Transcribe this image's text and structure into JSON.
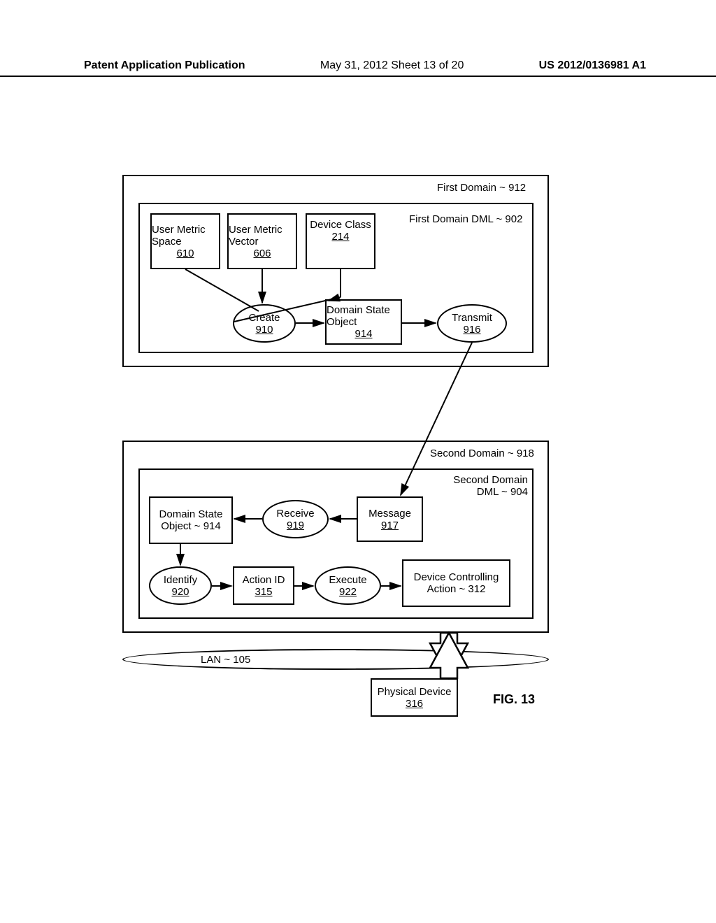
{
  "header": {
    "left": "Patent Application Publication",
    "center": "May 31, 2012  Sheet 13 of 20",
    "right": "US 2012/0136981 A1"
  },
  "domain1": {
    "label": "First Domain ~ 912",
    "dml_label": "First Domain DML ~ 902",
    "user_metric_space": {
      "title": "User Metric Space",
      "ref": "610"
    },
    "user_metric_vector": {
      "title": "User Metric Vector",
      "ref": "606"
    },
    "device_class": {
      "title": "Device Class",
      "ref": "214"
    },
    "create": {
      "title": "Create",
      "ref": "910"
    },
    "domain_state_object": {
      "title": "Domain State Object",
      "ref": "914"
    },
    "transmit": {
      "title": "Transmit",
      "ref": "916"
    }
  },
  "domain2": {
    "label": "Second Domain ~ 918",
    "dml_label": "Second Domain DML ~ 904",
    "domain_state_object": {
      "title": "Domain State Object ~ 914"
    },
    "receive": {
      "title": "Receive",
      "ref": "919"
    },
    "message": {
      "title": "Message",
      "ref": "917"
    },
    "identify": {
      "title": "Identify",
      "ref": "920"
    },
    "action_id": {
      "title": "Action ID",
      "ref": "315"
    },
    "execute": {
      "title": "Execute",
      "ref": "922"
    },
    "device_controlling": {
      "title": "Device Controlling Action ~ 312"
    }
  },
  "lan": {
    "title": "LAN ~ 105"
  },
  "physical_device": {
    "title": "Physical Device",
    "ref": "316"
  },
  "figure": "FIG. 13"
}
